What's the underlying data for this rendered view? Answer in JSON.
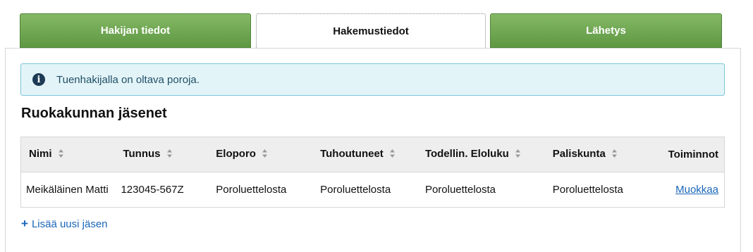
{
  "tabs": [
    {
      "label": "Hakijan tiedot",
      "state": "inactive"
    },
    {
      "label": "Hakemustiedot",
      "state": "active"
    },
    {
      "label": "Lähetys",
      "state": "inactive"
    }
  ],
  "notice": {
    "icon": "info-icon",
    "text": "Tuenhakijalla on oltava poroja."
  },
  "section": {
    "title": "Ruokakunnan jäsenet"
  },
  "table": {
    "headers": [
      "Nimi",
      "Tunnus",
      "Eloporo",
      "Tuhoutuneet",
      "Todellin. Eloluku",
      "Paliskunta",
      "Toiminnot"
    ],
    "rows": [
      {
        "nimi": "Meikäläinen Matti",
        "tunnus": "123045-567Z",
        "eloporo": "Poroluettelosta",
        "tuhoutuneet": "Poroluettelosta",
        "eloluku": "Poroluettelosta",
        "paliskunta": "Poroluettelosta",
        "action": "Muokkaa"
      }
    ]
  },
  "add_member": {
    "icon": "plus-icon",
    "label": "Lisää uusi jäsen"
  },
  "colors": {
    "tab_green": "#6ea852",
    "link": "#1a66b8",
    "notice_bg": "#e3f4f8",
    "notice_border": "#7cc4d6"
  }
}
